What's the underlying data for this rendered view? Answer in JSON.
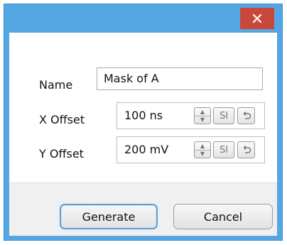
{
  "titlebar": {
    "close_icon": "close-icon",
    "close_color": "#c9483b",
    "accent": "#54a7e2"
  },
  "form": {
    "name": {
      "label": "Name",
      "value": "Mask of A"
    },
    "x_offset": {
      "label": "X Offset",
      "value": "100 ns",
      "si_label": "SI"
    },
    "y_offset": {
      "label": "Y Offset",
      "value": "200 mV",
      "si_label": "SI"
    }
  },
  "buttons": {
    "generate": "Generate",
    "cancel": "Cancel"
  }
}
